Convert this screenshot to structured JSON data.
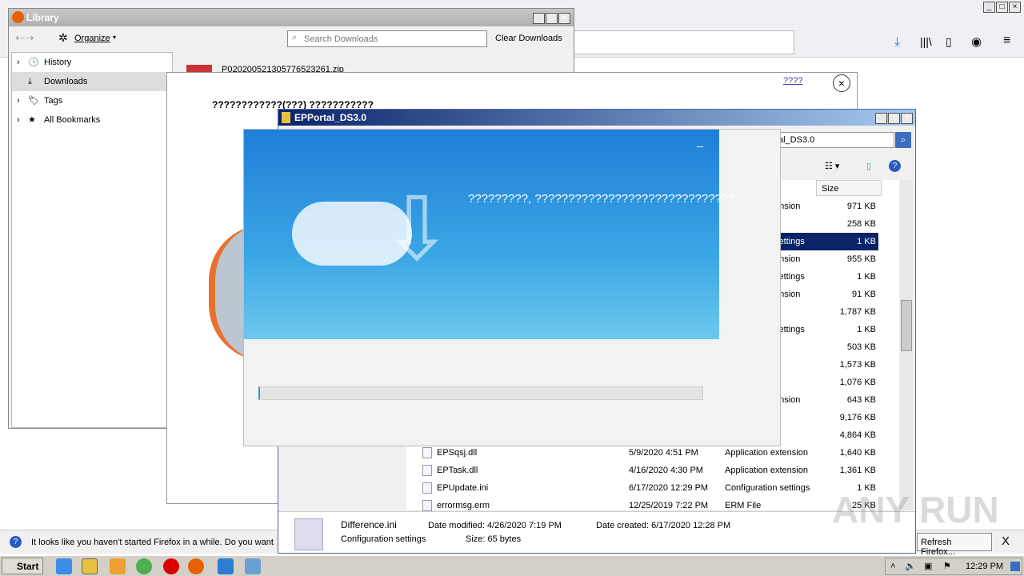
{
  "library": {
    "title": "Library",
    "organize": "Organize",
    "search_placeholder": "Search Downloads",
    "clear": "Clear Downloads",
    "sidebar": [
      {
        "label": "History"
      },
      {
        "label": "Downloads"
      },
      {
        "label": "Tags"
      },
      {
        "label": "All Bookmarks"
      }
    ],
    "download_item": "P020200521305776523261.zip"
  },
  "dialog": {
    "link": "????",
    "heading": "????????????(???) ???????????"
  },
  "explorer": {
    "title": "EPPortal_DS3.0",
    "address": "al_DS3.0",
    "col_size": "Size",
    "rows": [
      {
        "name": "",
        "date": "",
        "type": "ension",
        "size": "971 KB"
      },
      {
        "name": "",
        "date": "",
        "type": "",
        "size": "258 KB"
      },
      {
        "name": "",
        "date": "",
        "type": "settings",
        "size": "1 KB",
        "selected": true
      },
      {
        "name": "",
        "date": "",
        "type": "ension",
        "size": "955 KB"
      },
      {
        "name": "",
        "date": "",
        "type": "settings",
        "size": "1 KB"
      },
      {
        "name": "",
        "date": "",
        "type": "ension",
        "size": "91 KB"
      },
      {
        "name": "",
        "date": "",
        "type": "",
        "size": "1,787 KB"
      },
      {
        "name": "",
        "date": "",
        "type": "settings",
        "size": "1 KB"
      },
      {
        "name": "",
        "date": "",
        "type": "",
        "size": "503 KB"
      },
      {
        "name": "",
        "date": "",
        "type": "",
        "size": "1,573 KB"
      },
      {
        "name": "",
        "date": "",
        "type": "",
        "size": "1,076 KB"
      },
      {
        "name": "",
        "date": "",
        "type": "ension",
        "size": "643 KB"
      },
      {
        "name": "",
        "date": "",
        "type": "",
        "size": "9,176 KB"
      },
      {
        "name": "",
        "date": "",
        "type": "",
        "size": "4,864 KB"
      },
      {
        "name": "EPSqsj.dll",
        "date": "5/9/2020 4:51 PM",
        "type": "Application extension",
        "size": "1,640 KB"
      },
      {
        "name": "EPTask.dll",
        "date": "4/16/2020 4:30 PM",
        "type": "Application extension",
        "size": "1,361 KB"
      },
      {
        "name": "EPUpdate.ini",
        "date": "6/17/2020 12:29 PM",
        "type": "Configuration settings",
        "size": "1 KB"
      },
      {
        "name": "errormsg.erm",
        "date": "12/25/2019 7:22 PM",
        "type": "ERM File",
        "size": "25 KB"
      }
    ],
    "details": {
      "name": "Difference.ini",
      "type": "Configuration settings",
      "modified": "Date modified: 4/26/2020 7:19 PM",
      "created": "Date created: 6/17/2020 12:28 PM",
      "size": "Size: 65 bytes"
    }
  },
  "installer": {
    "minimize": "_",
    "message": "?????????, ??????????????????????????????",
    "progress": 0
  },
  "notification": {
    "text": "It looks like you haven't started Firefox in a while. Do you want",
    "refresh": "Refresh Firefox...",
    "close": "X"
  },
  "taskbar": {
    "start": "Start",
    "clock": "12:29 PM"
  },
  "watermark": "ANY RUN"
}
